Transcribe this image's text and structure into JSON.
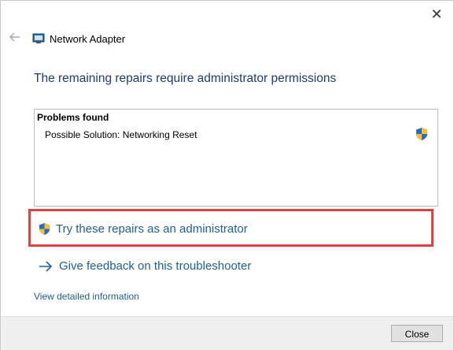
{
  "window": {
    "title": "Network Adapter",
    "close_glyph": "✕"
  },
  "main": {
    "heading": "The remaining repairs require administrator permissions",
    "problems": {
      "title": "Problems found",
      "items": [
        {
          "label": "Possible Solution: Networking Reset",
          "icon": "uac-shield-icon"
        }
      ]
    },
    "links": {
      "admin_repairs": "Try these repairs as an administrator",
      "feedback": "Give feedback on this troubleshooter",
      "details": "View detailed information"
    }
  },
  "footer": {
    "close_label": "Close"
  },
  "colors": {
    "heading": "#1c3d6e",
    "link": "#1f5f96",
    "highlight": "#e2423e"
  }
}
